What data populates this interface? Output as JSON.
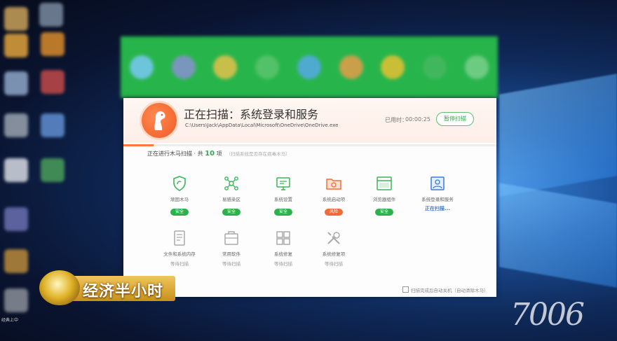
{
  "scan_window": {
    "title": "正在扫描：系统登录和服务",
    "path": "C:\\Users\\Jack\\AppData\\Local\\Microsoft\\OneDrive\\OneDrive.exe",
    "elapsed_label": "已用时：",
    "elapsed_value": "00:00:25",
    "pause_button": "暂停扫描",
    "progress_fraction": 0.08,
    "subtitle_prefix": "正在进行木马扫描 · 共 ",
    "subtitle_count": "10",
    "subtitle_suffix": " 项",
    "subtitle_note": "（扫描系统是否存在病毒木马）",
    "row1": [
      {
        "label": "顽固木马",
        "status": "安全",
        "status_type": "safe",
        "icon": "shield-icon"
      },
      {
        "label": "易感染区",
        "status": "安全",
        "status_type": "safe",
        "icon": "network-icon"
      },
      {
        "label": "系统设置",
        "status": "安全",
        "status_type": "safe",
        "icon": "monitor-settings-icon"
      },
      {
        "label": "系统启动项",
        "status": "风险",
        "status_type": "risk",
        "icon": "startup-folder-icon"
      },
      {
        "label": "浏览器组件",
        "status": "安全",
        "status_type": "safe",
        "icon": "browser-window-icon"
      },
      {
        "label": "系统登录和服务",
        "status": "正在扫描...",
        "status_type": "scanning",
        "icon": "login-service-icon"
      }
    ],
    "row2": [
      {
        "label": "文件和系统内存",
        "status": "等待扫描",
        "icon": "file-memory-icon"
      },
      {
        "label": "常用软件",
        "status": "等待扫描",
        "icon": "software-icon"
      },
      {
        "label": "系统修复",
        "status": "等待扫描",
        "icon": "windows-icon"
      },
      {
        "label": "系统修复项",
        "status": "等待扫描",
        "icon": "tools-icon"
      }
    ],
    "footer_checkbox": "扫描完成后自动关机（自动清除木马）"
  },
  "overlay": {
    "channel_logo_text": "经济半小时",
    "corner_text": "经典上中",
    "watermark": "7006"
  },
  "colors": {
    "toolbar_green": "#27b54b",
    "accent_orange": "#ef5a22",
    "safe_green": "#2bb24c",
    "risk_orange": "#f06a3a",
    "scanning_blue": "#3a7bd5"
  }
}
